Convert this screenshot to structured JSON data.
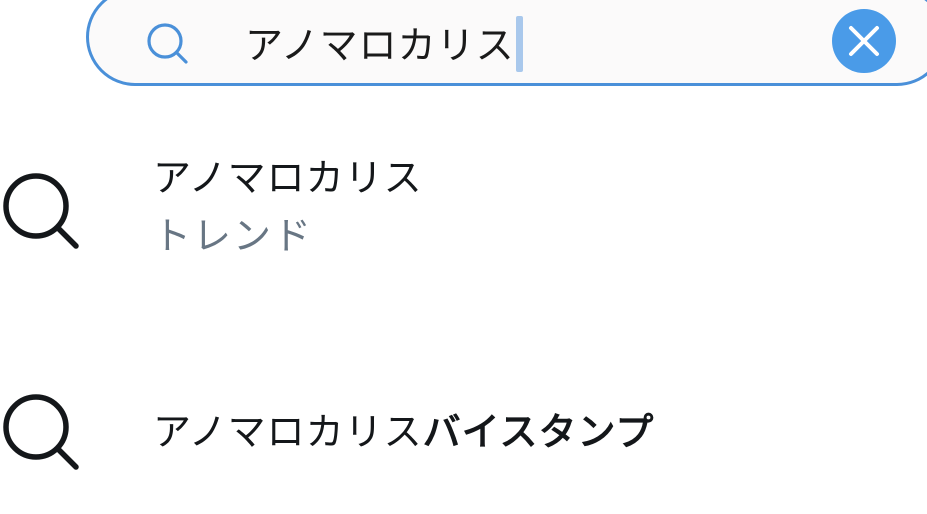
{
  "search": {
    "query": "アノマロカリス",
    "icon": "search-icon",
    "clear_icon": "close-icon",
    "accent_color": "#4a90d9",
    "clear_button_color": "#4a9be8"
  },
  "suggestions": [
    {
      "icon": "search-icon",
      "title": "アノマロカリス",
      "subtitle": "トレンド"
    },
    {
      "icon": "search-icon",
      "title_prefix": "アノマロカリス",
      "title_bold": "バイスタンプ"
    }
  ]
}
